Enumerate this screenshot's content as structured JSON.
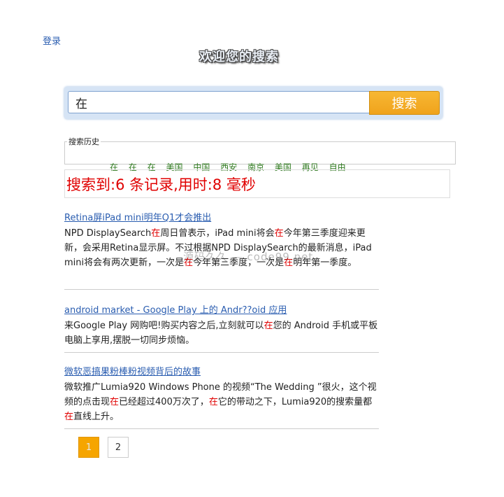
{
  "header": {
    "login_label": "登录",
    "title": "欢迎您的搜索"
  },
  "search": {
    "query": "在",
    "button_label": "搜索"
  },
  "history": {
    "legend": "搜索历史",
    "items": [
      "在",
      "在",
      "在",
      "美国",
      "中国",
      "西安",
      "南京",
      "美国",
      "再见",
      "自由"
    ]
  },
  "stats": {
    "text": "搜索到:6 条记录,用时:8 毫秒"
  },
  "results": [
    {
      "title": "Retina屏iPad mini明年Q1才会推出",
      "body": [
        {
          "t": "NPD DisplaySearch",
          "h": false
        },
        {
          "t": "在",
          "h": true
        },
        {
          "t": "周日曾表示，iPad mini将会",
          "h": false
        },
        {
          "t": "在",
          "h": true
        },
        {
          "t": "今年第三季度迎来更新，会采用Retina显示屏。不过根据NPD DisplaySearch的最新消息，iPad mini将会有两次更新，一次是",
          "h": false
        },
        {
          "t": "在",
          "h": true
        },
        {
          "t": "今年第三季度，一次是",
          "h": false
        },
        {
          "t": "在",
          "h": true
        },
        {
          "t": "明年第一季度。",
          "h": false
        }
      ]
    },
    {
      "title": "android market - Google Play 上的 Andr??oid 应用",
      "body": [
        {
          "t": "来Google Play 网购吧!购买内容之后,立刻就可以",
          "h": false
        },
        {
          "t": "在",
          "h": true
        },
        {
          "t": "您的 Android 手机或平板电脑上享用,摆脱一切同步烦恼。",
          "h": false
        }
      ]
    },
    {
      "title": "微软恶搞果粉棒粉视频背后的故事",
      "body": [
        {
          "t": "微软推广Lumia920 Windows Phone 的视频“The Wedding ”很火，这个视频的点击现",
          "h": false
        },
        {
          "t": "在",
          "h": true
        },
        {
          "t": "已经超过400万次了，",
          "h": false
        },
        {
          "t": "在",
          "h": true
        },
        {
          "t": "它的带动之下，Lumia920的搜索量都",
          "h": false
        },
        {
          "t": "在",
          "h": true
        },
        {
          "t": "直线上升。",
          "h": false
        }
      ]
    }
  ],
  "watermark": "源码久久 — code99.net",
  "pagination": {
    "pages": [
      "1",
      "2"
    ],
    "current": "1",
    "active_color": "#f6a500"
  }
}
